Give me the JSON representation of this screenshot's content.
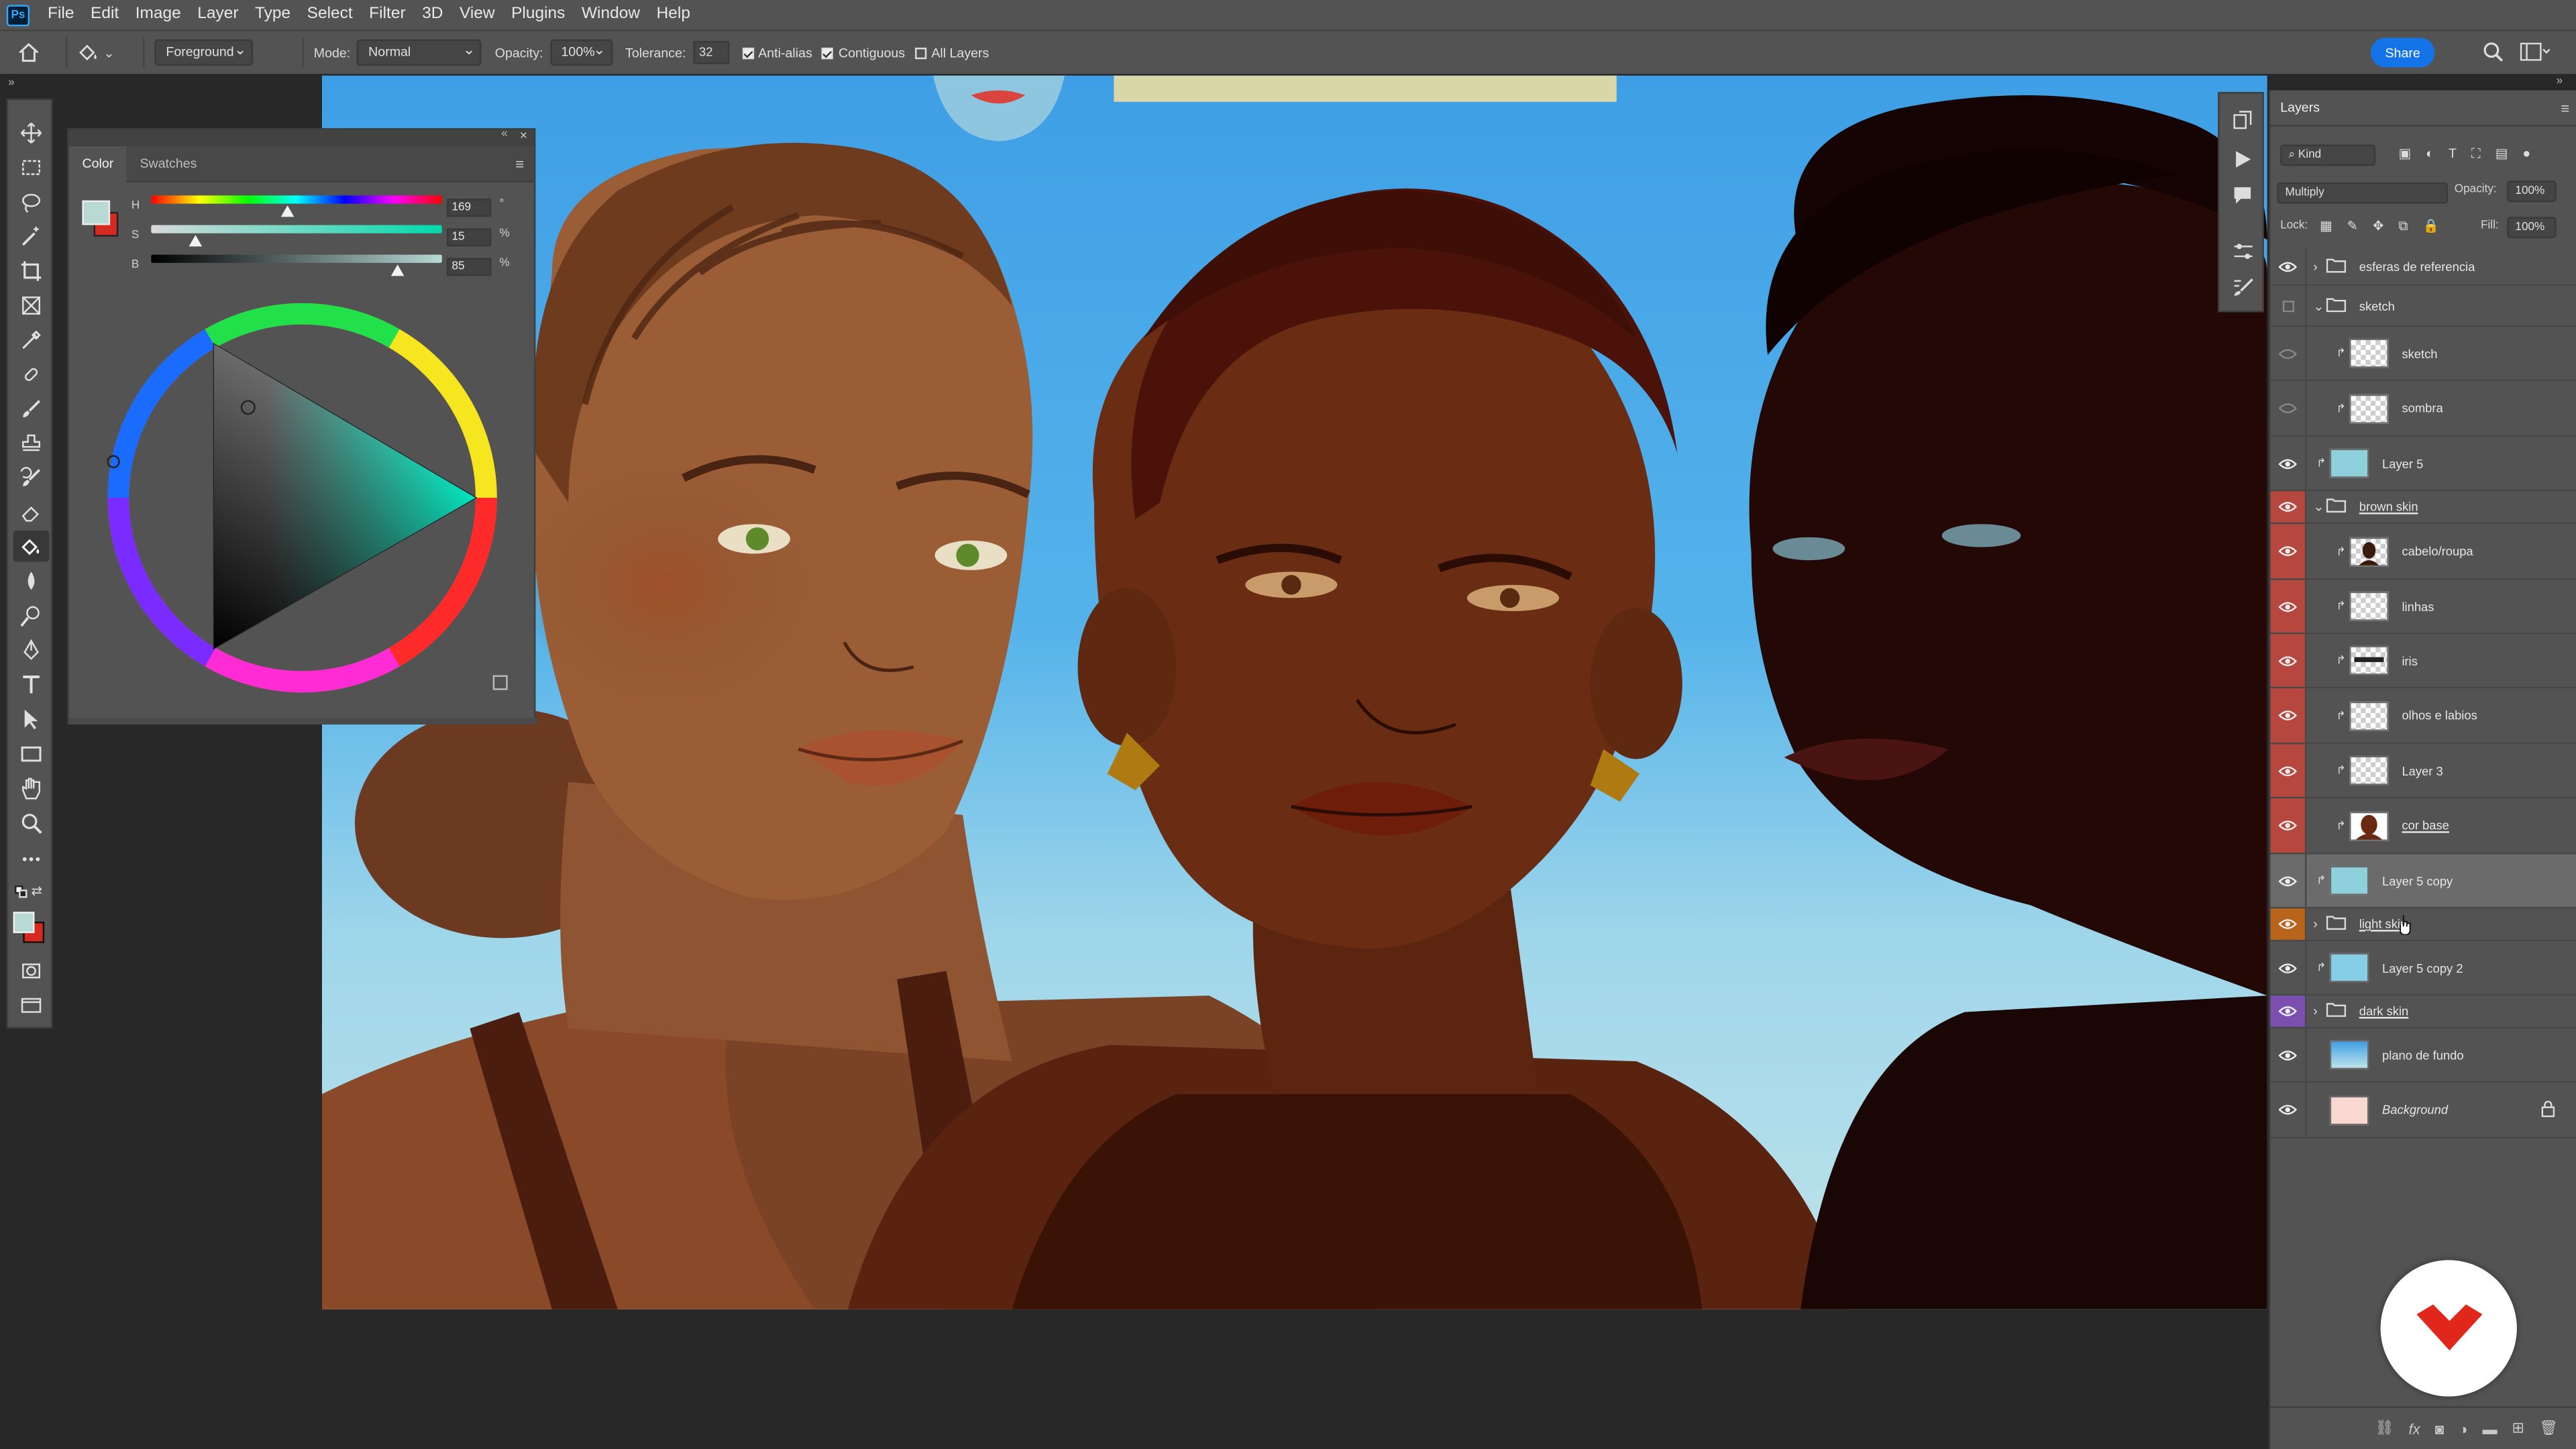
{
  "app": {
    "logo_text": "Ps"
  },
  "menu": [
    "File",
    "Edit",
    "Image",
    "Layer",
    "Type",
    "Select",
    "Filter",
    "3D",
    "View",
    "Plugins",
    "Window",
    "Help"
  ],
  "options_bar": {
    "fill_source": "Foreground",
    "mode_label": "Mode:",
    "mode_value": "Normal",
    "opacity_label": "Opacity:",
    "opacity_value": "100%",
    "tolerance_label": "Tolerance:",
    "tolerance_value": "32",
    "anti_alias": "Anti-alias",
    "contiguous": "Contiguous",
    "all_layers": "All Layers",
    "share": "Share"
  },
  "color_panel": {
    "tabs": [
      "Color",
      "Swatches"
    ],
    "h_label": "H",
    "h_value": "169",
    "h_unit": "°",
    "s_label": "S",
    "s_value": "15",
    "s_unit": "%",
    "b_label": "B",
    "b_value": "85",
    "b_unit": "%",
    "h_fraction": 0.47,
    "s_fraction": 0.15,
    "b_fraction": 0.85,
    "foreground": "#b8d9d4",
    "background": "#d42a22"
  },
  "layers_panel": {
    "title": "Layers",
    "filter_kind": "Kind",
    "blend_mode": "Multiply",
    "opacity_label": "Opacity:",
    "opacity_value": "100%",
    "lock_label": "Lock:",
    "fill_label": "Fill:",
    "fill_value": "100%",
    "layers": [
      {
        "name": "esferas de referencia",
        "type": "group",
        "visible": true,
        "tag": "",
        "indent": 0
      },
      {
        "name": "sketch",
        "type": "group-open",
        "visible": false,
        "tag": "",
        "indent": 0
      },
      {
        "name": "sketch",
        "type": "layer",
        "visible": false,
        "tag": "",
        "indent": 1
      },
      {
        "name": "sombra",
        "type": "layer",
        "visible": false,
        "tag": "",
        "indent": 1
      },
      {
        "name": "Layer 5",
        "type": "layer",
        "visible": true,
        "tag": "",
        "indent": 0
      },
      {
        "name": "brown skin",
        "type": "group-open",
        "visible": true,
        "tag": "red",
        "indent": 0
      },
      {
        "name": "cabelo/roupa",
        "type": "layer",
        "visible": true,
        "tag": "red",
        "indent": 1
      },
      {
        "name": "linhas",
        "type": "layer",
        "visible": true,
        "tag": "red",
        "indent": 1
      },
      {
        "name": "iris",
        "type": "layer",
        "visible": true,
        "tag": "red",
        "indent": 1
      },
      {
        "name": "olhos e labios",
        "type": "layer",
        "visible": true,
        "tag": "red",
        "indent": 1
      },
      {
        "name": "Layer 3",
        "type": "layer",
        "visible": true,
        "tag": "red",
        "indent": 1
      },
      {
        "name": "cor base",
        "type": "layer",
        "visible": true,
        "tag": "red",
        "indent": 1
      },
      {
        "name": "Layer 5 copy",
        "type": "layer",
        "visible": true,
        "tag": "",
        "indent": 0
      },
      {
        "name": "light skin",
        "type": "group",
        "visible": true,
        "tag": "orange",
        "indent": 0
      },
      {
        "name": "Layer 5 copy 2",
        "type": "layer",
        "visible": true,
        "tag": "",
        "indent": 0
      },
      {
        "name": "dark skin",
        "type": "group",
        "visible": true,
        "tag": "violet",
        "indent": 0
      },
      {
        "name": "plano de fundo",
        "type": "layer",
        "visible": true,
        "tag": "",
        "indent": 0
      },
      {
        "name": "Background",
        "type": "background",
        "visible": true,
        "tag": "",
        "indent": 0
      }
    ]
  },
  "colors": {
    "ui_bg": "#535353",
    "workspace": "#282828",
    "accent_blue": "#1473e6",
    "tag_red": "#b5473f",
    "tag_orange": "#b8641a",
    "tag_violet": "#7a4fb0"
  }
}
